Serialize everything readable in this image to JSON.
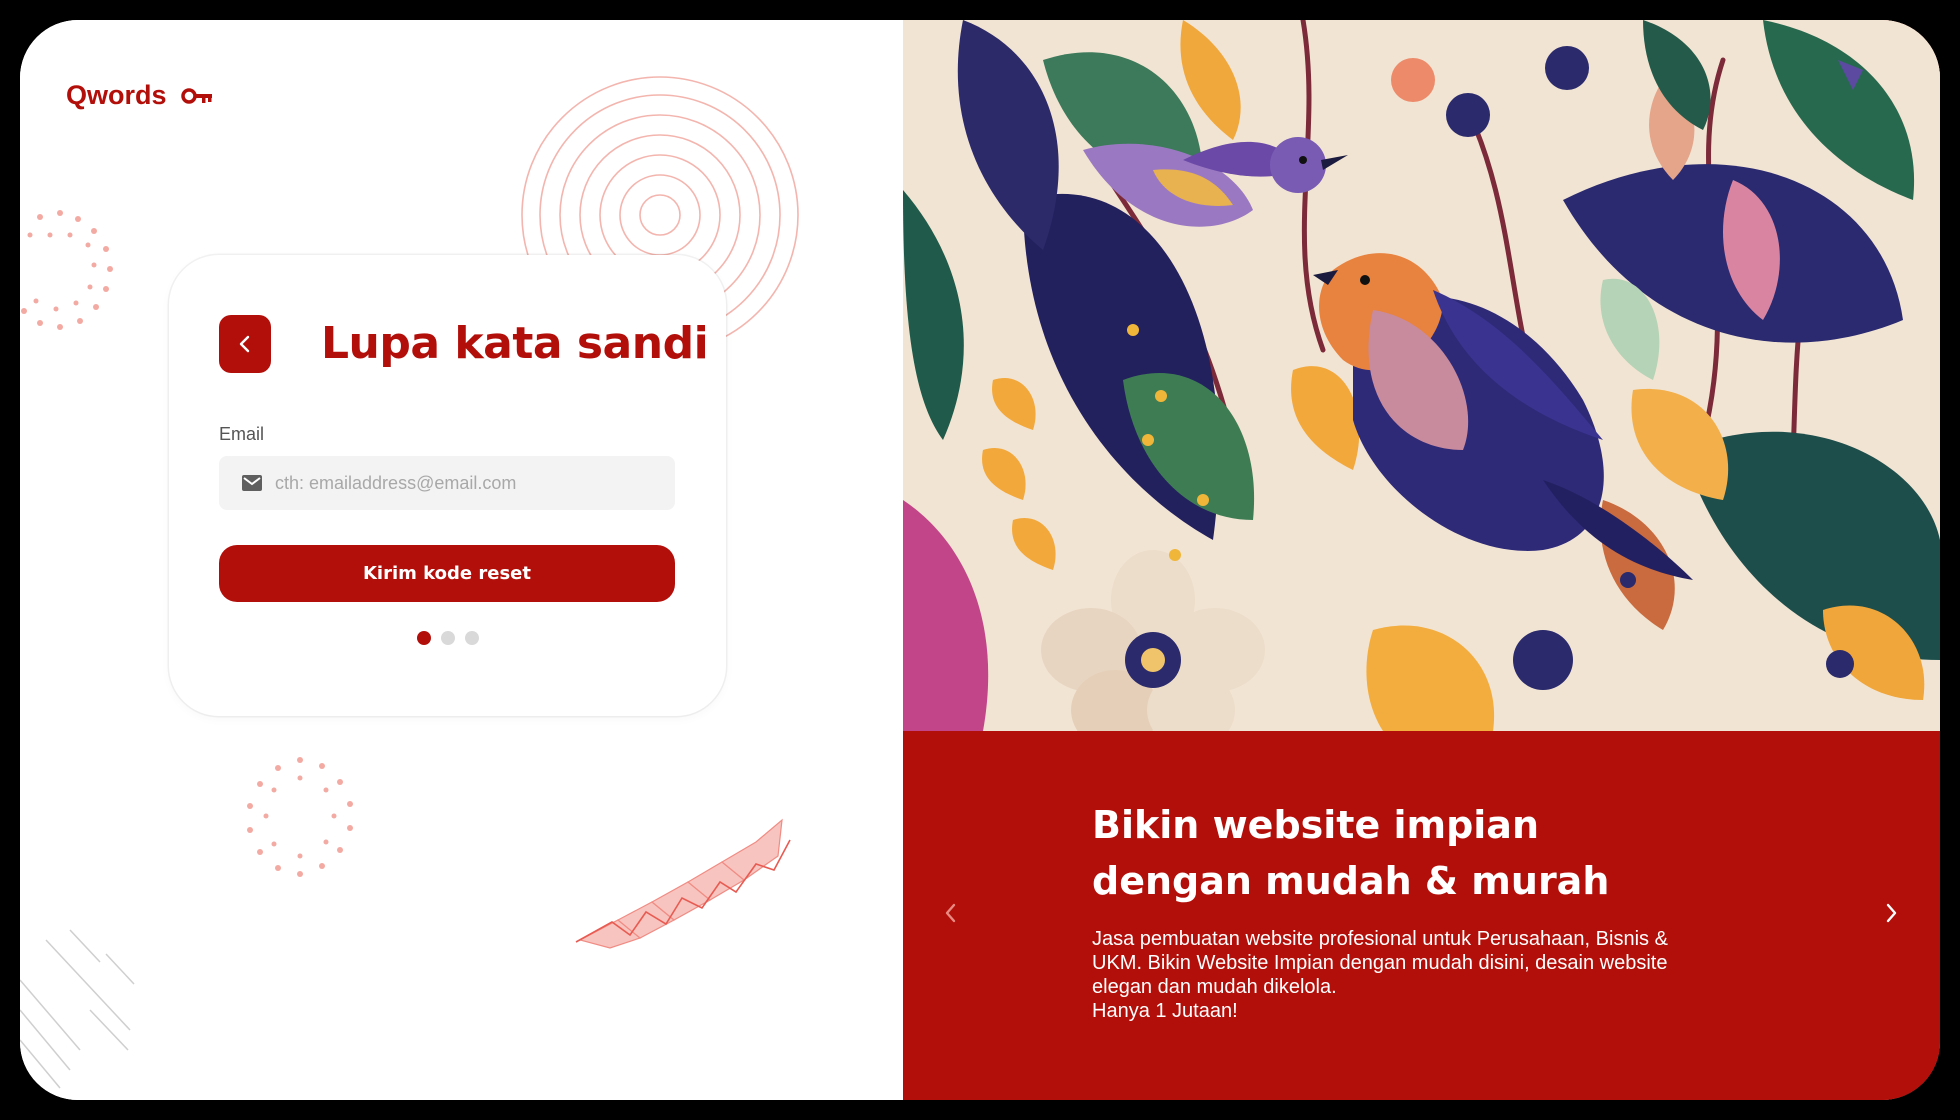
{
  "brand": {
    "name": "Qwords",
    "accent": "#b30f0a"
  },
  "form": {
    "back_icon": "chevron-left-icon",
    "title": "Lupa kata sandi",
    "email_label": "Email",
    "email_placeholder": "cth: emailaddress@email.com",
    "email_value": "",
    "mail_icon": "mail-icon",
    "submit_label": "Kirim kode reset",
    "steps": {
      "total": 3,
      "active": 1
    }
  },
  "promo": {
    "headline_line1": "Bikin website impian",
    "headline_line2": "dengan mudah & murah",
    "desc_line1": "Jasa pembuatan website profesional untuk Perusahaan, Bisnis &",
    "desc_line2": "UKM. Bikin Website Impian dengan mudah disini, desain website",
    "desc_line3": "elegan dan mudah dikelola.",
    "desc_line4": "Hanya 1 Jutaan!",
    "prev_icon": "chevron-left-icon",
    "next_icon": "chevron-right-icon"
  }
}
